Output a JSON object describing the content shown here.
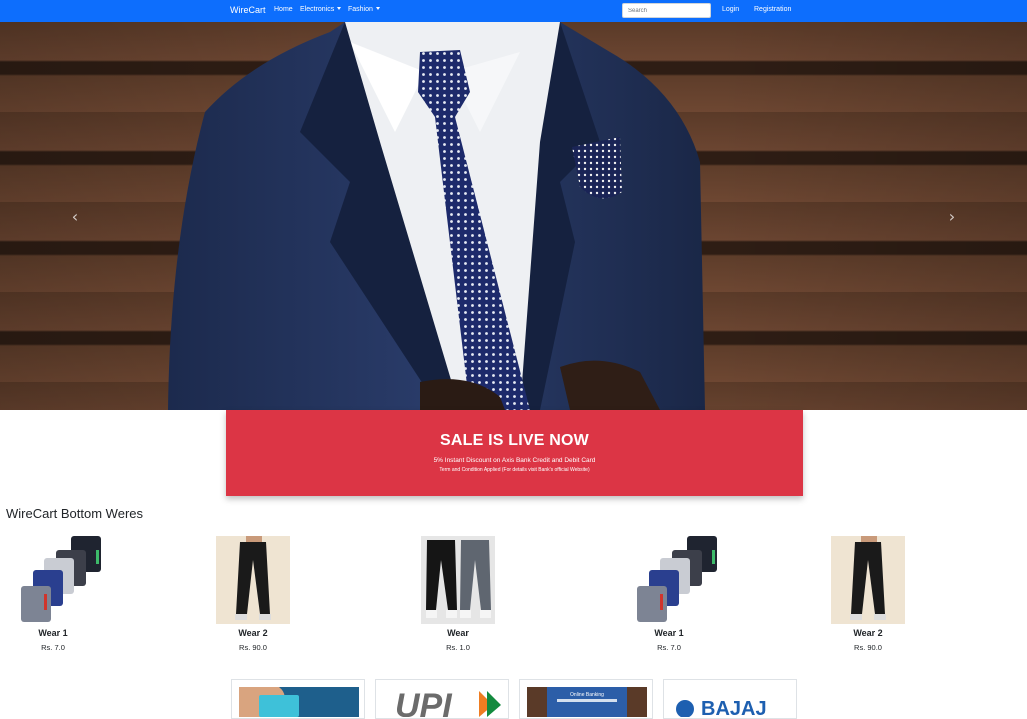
{
  "navbar": {
    "brand": "WireCart",
    "links": [
      {
        "label": "Home"
      },
      {
        "label": "Electronics"
      },
      {
        "label": "Fashion"
      }
    ],
    "search_placeholder": "Search",
    "login": "Login",
    "register": "Registration",
    "color": "#0d6efd"
  },
  "hero": {
    "prev_icon": "chevron-left-icon",
    "next_icon": "chevron-right-icon"
  },
  "sale": {
    "title": "SALE IS LIVE NOW",
    "subtitle": "5% Instant Discount on Axis Bank Credit and Debit Card",
    "terms": "Term and Condition Applied (For details visit Bank's official Website)",
    "color": "#dc3545"
  },
  "section": {
    "title": "WireCart Bottom Weres"
  },
  "products": [
    {
      "name": "Wear 1",
      "price": "Rs. 7.0"
    },
    {
      "name": "Wear 2",
      "price": "Rs. 90.0"
    },
    {
      "name": "Wear",
      "price": "Rs. 1.0"
    },
    {
      "name": "Wear 1",
      "price": "Rs. 7.0"
    },
    {
      "name": "Wear 2",
      "price": "Rs. 90.0"
    }
  ],
  "payments": [
    {
      "label": ""
    },
    {
      "label": "UPI"
    },
    {
      "label": "Online Banking"
    },
    {
      "label": "BAJAJ"
    }
  ]
}
